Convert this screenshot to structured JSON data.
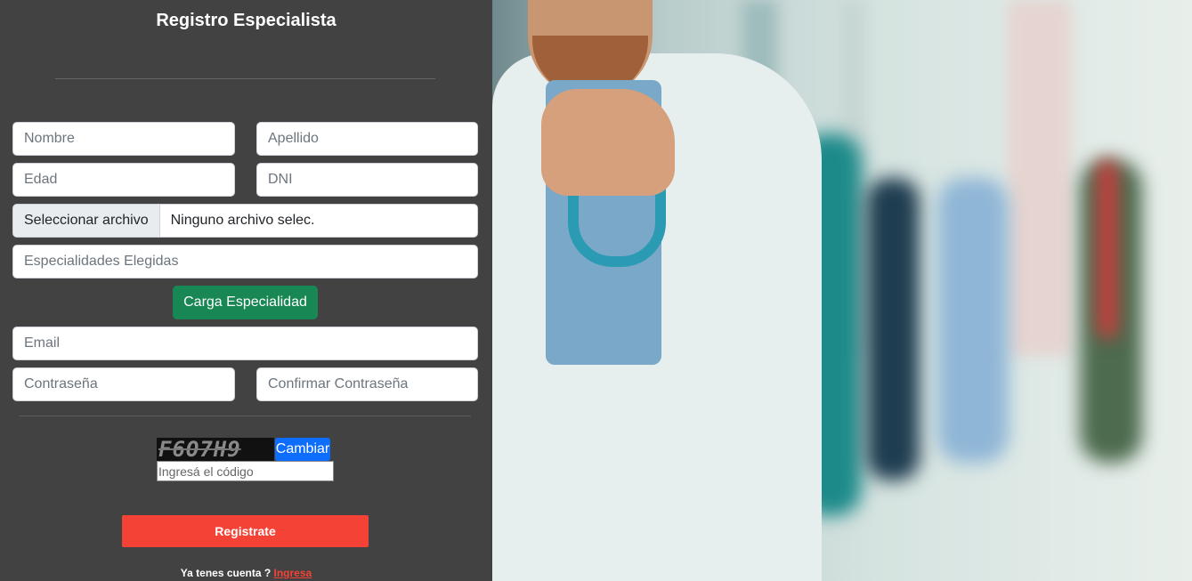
{
  "form": {
    "title": "Registro Especialista",
    "nombre_placeholder": "Nombre",
    "apellido_placeholder": "Apellido",
    "edad_placeholder": "Edad",
    "dni_placeholder": "DNI",
    "file_button_label": "Seleccionar archivo",
    "file_status": "Ninguno archivo selec.",
    "especialidades_placeholder": "Especialidades Elegidas",
    "carga_button_label": "Carga Especialidad",
    "email_placeholder": "Email",
    "password_placeholder": "Contraseña",
    "confirm_password_placeholder": "Confirmar Contraseña"
  },
  "captcha": {
    "code": "F6O7H9",
    "change_label": "Cambiar",
    "input_placeholder": "Ingresá el código"
  },
  "register_button_label": "Registrate",
  "login": {
    "prompt": "Ya tenes cuenta ? ",
    "link_label": "Ingresa"
  },
  "colors": {
    "panel_bg": "#424242",
    "green_button": "#198754",
    "blue_button": "#0d6efd",
    "red_button": "#f44336"
  },
  "photo": {
    "icon": "doctor-hospital-photo"
  }
}
